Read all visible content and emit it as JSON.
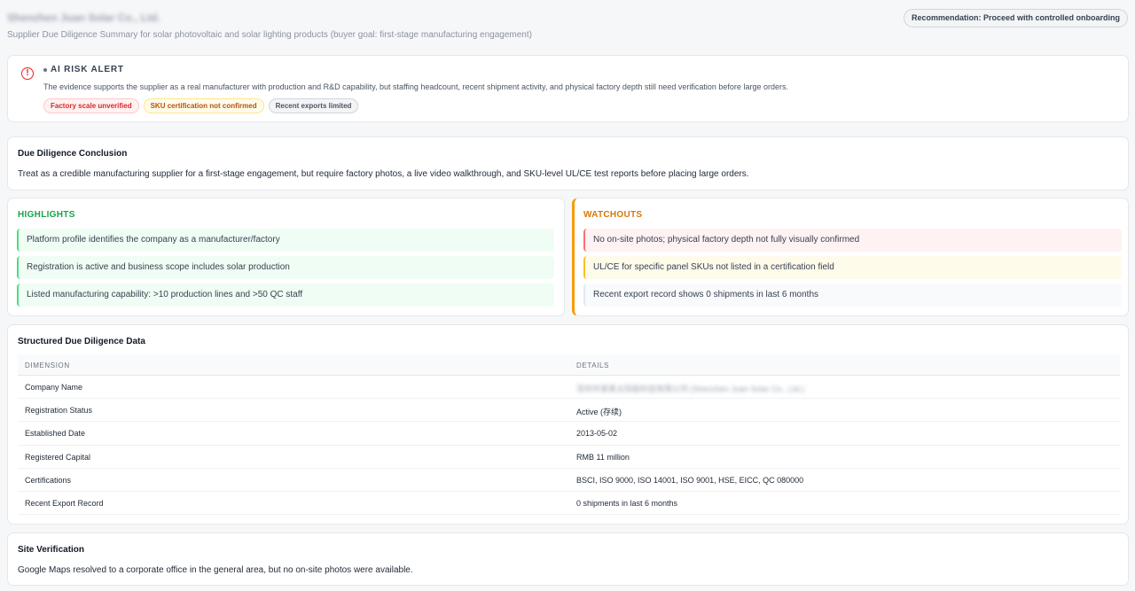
{
  "header": {
    "company_name": "Shenzhen Juan Solar Co., Ltd.",
    "subtitle": "Supplier Due Diligence Summary for solar photovoltaic and solar lighting products (buyer goal: first-stage manufacturing engagement)",
    "recommendation": "Recommendation: Proceed with controlled onboarding"
  },
  "alert": {
    "icon": "alert-circle-icon",
    "title": "AI RISK ALERT",
    "description": "The evidence supports the supplier as a real manufacturer with production and R&D capability, but staffing headcount, recent shipment activity, and physical factory depth still need verification before large orders.",
    "tags": [
      {
        "label": "Factory scale unverified",
        "tone": "red"
      },
      {
        "label": "SKU certification not confirmed",
        "tone": "amber"
      },
      {
        "label": "Recent exports limited",
        "tone": "gray"
      }
    ]
  },
  "conclusion": {
    "title": "Due Diligence Conclusion",
    "text": "Treat as a credible manufacturing supplier for a first-stage engagement, but require factory photos, a live video walkthrough, and SKU-level UL/CE test reports before placing large orders."
  },
  "highlights": {
    "title": "HIGHLIGHTS",
    "items": [
      "Platform profile identifies the company as a manufacturer/factory",
      "Registration is active and business scope includes solar production",
      "Listed manufacturing capability: >10 production lines and >50 QC staff"
    ]
  },
  "watchouts": {
    "title": "WATCHOUTS",
    "items": [
      "No on-site photos; physical factory depth not fully visually confirmed",
      "UL/CE for specific panel SKUs not listed in a certification field",
      "Recent export record shows 0 shipments in last 6 months"
    ]
  },
  "table": {
    "title": "Structured Due Diligence Data",
    "headers": [
      "DIMENSION",
      "DETAILS"
    ],
    "rows": [
      {
        "dimension": "Company Name",
        "details": "深圳市某某太阳能科技有限公司 (Shenzhen Juan Solar Co., Ltd.)"
      },
      {
        "dimension": "Registration Status",
        "details": "Active (存续)"
      },
      {
        "dimension": "Established Date",
        "details": "2013-05-02"
      },
      {
        "dimension": "Registered Capital",
        "details": "RMB 11 million"
      },
      {
        "dimension": "Certifications",
        "details": "BSCI, ISO 9000, ISO 14001, ISO 9001, HSE, EICC, QC 080000"
      },
      {
        "dimension": "Recent Export Record",
        "details": "0 shipments in last 6 months"
      }
    ]
  },
  "site": {
    "title": "Site Verification",
    "text": "Google Maps resolved to a corporate office in the general area, but no on-site photos were available."
  }
}
